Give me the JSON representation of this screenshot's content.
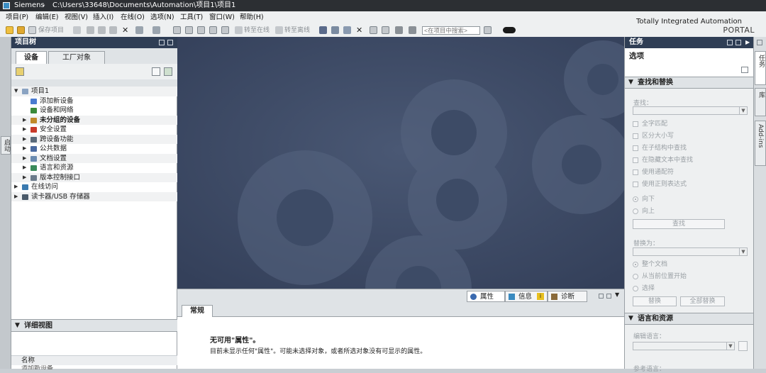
{
  "window": {
    "app_name": "Siemens",
    "separator": "-",
    "path": "C:\\Users\\33648\\Documents\\Automation\\项目1\\项目1"
  },
  "menu": [
    "项目(P)",
    "编辑(E)",
    "视图(V)",
    "插入(I)",
    "在线(O)",
    "选项(N)",
    "工具(T)",
    "窗口(W)",
    "帮助(H)"
  ],
  "toolbar": {
    "save_project": "保存项目",
    "go_online": "转至在线",
    "go_offline": "转至离线",
    "search_placeholder": "<在项目中搜索>"
  },
  "brand": {
    "line1": "Totally Integrated Automation",
    "line2": "PORTAL"
  },
  "left_rail": {
    "tab_label": "启动"
  },
  "project_tree": {
    "title": "项目树",
    "tabs": [
      "设备",
      "工厂对象"
    ],
    "active_tab": "设备",
    "items": [
      {
        "label": "项目1",
        "expanded": true,
        "color": "#8aa3c2"
      },
      {
        "label": "添加新设备",
        "color": "#4a7bd0"
      },
      {
        "label": "设备和网络",
        "color": "#3a8a3a"
      },
      {
        "label": "未分组的设备",
        "color": "#c08a2a",
        "bold": true
      },
      {
        "label": "安全设置",
        "color": "#c83a2a"
      },
      {
        "label": "跨设备功能",
        "color": "#5a6a7a"
      },
      {
        "label": "公共数据",
        "color": "#4a6aa0"
      },
      {
        "label": "文档设置",
        "color": "#6a8ab0"
      },
      {
        "label": "语言和资源",
        "color": "#3a8a5a"
      },
      {
        "label": "版本控制接口",
        "color": "#6a7a8a"
      },
      {
        "label": "在线访问",
        "color": "#3a7ab0"
      },
      {
        "label": "读卡器/USB 存储器",
        "color": "#4a5a6a"
      }
    ]
  },
  "detail_view": {
    "title": "详细视图",
    "column_name": "名称",
    "row1": "添加新设备"
  },
  "inspector": {
    "tabs": [
      {
        "label": "属性",
        "color": "#3a6ab0"
      },
      {
        "label": "信息",
        "color": "#3a8ac0"
      },
      {
        "label": "诊断",
        "color": "#8a6a3a"
      }
    ],
    "info_badge": "i",
    "active_tab": "常规",
    "no_props_title": "无可用\"属性\"。",
    "no_props_text": "目前未显示任何\"属性\"。可能未选择对象，或者所选对象没有可显示的属性。"
  },
  "task_panel": {
    "title": "任务",
    "options_title": "选项",
    "find_replace": {
      "title": "查找和替换",
      "find_label": "查找：",
      "options": [
        "全字匹配",
        "区分大小写",
        "在子结构中查找",
        "在隐藏文本中查找",
        "使用通配符",
        "使用正则表达式"
      ],
      "directions": [
        "向下",
        "向上"
      ],
      "find_button": "查找",
      "replace_label": "替换为：",
      "scopes": [
        "整个文档",
        "从当前位置开始",
        "选择"
      ],
      "replace_button": "替换",
      "replace_all_button": "全部替换"
    },
    "lang_resources": {
      "title": "语言和资源",
      "edit_lang_label": "编辑语言：",
      "ref_lang_label": "参考语言："
    }
  },
  "right_rail": {
    "tabs": [
      "任务",
      "库",
      "Add-ins"
    ]
  },
  "colors": {
    "workspace_bg": "#3d4b66",
    "panel_header": "#2f3e55",
    "info_badge": "#e8c020"
  }
}
